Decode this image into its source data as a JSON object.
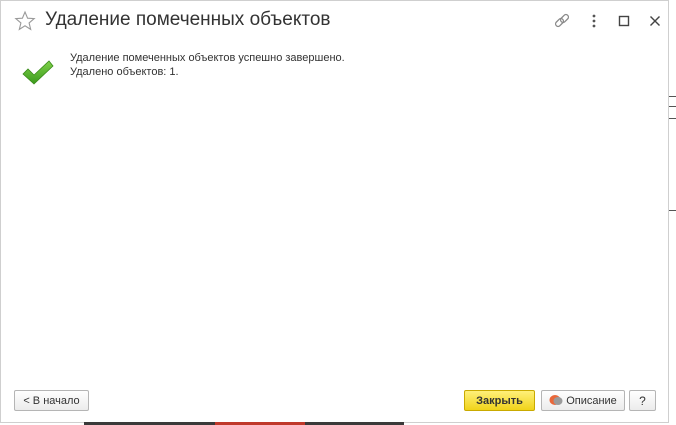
{
  "window": {
    "title": "Удаление помеченных объектов"
  },
  "message": {
    "line1": "Удаление помеченных объектов успешно завершено.",
    "line2": "Удалено объектов: 1."
  },
  "buttons": {
    "back": "< В начало",
    "close": "Закрыть",
    "description": "Описание",
    "help": "?"
  },
  "icons": {
    "favorite": "star-icon",
    "link": "link-icon",
    "more": "more-icon",
    "maximize": "maximize-icon",
    "close": "close-icon",
    "success": "checkmark-icon",
    "description": "description-icon"
  },
  "colors": {
    "accent_button": "#f0d31a",
    "check_green": "#4caf2a",
    "text": "#333333"
  }
}
